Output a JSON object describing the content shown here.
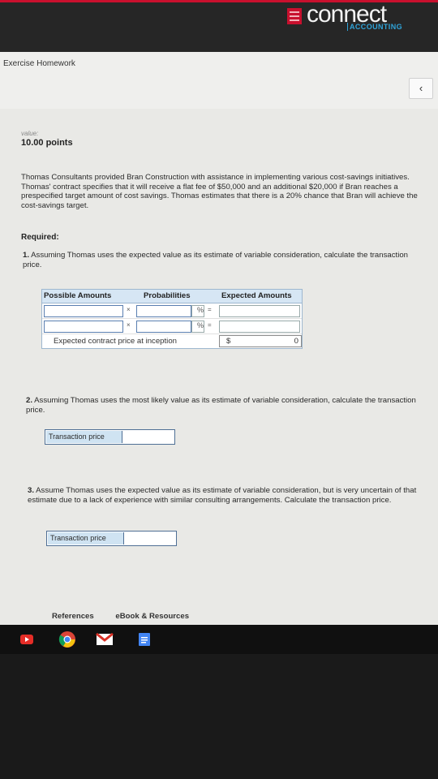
{
  "brand": {
    "name": "connect",
    "sub": "ACCOUNTING"
  },
  "header": {
    "title": "Exercise Homework",
    "back_icon": "chevron-left-icon",
    "back_glyph": "‹"
  },
  "value": {
    "label": "value:",
    "points": "10.00 points"
  },
  "problem_text": "Thomas Consultants provided Bran Construction with assistance in implementing various cost-savings initiatives. Thomas' contract specifies that it will receive a flat fee of $50,000 and an additional $20,000 if Bran reaches a prespecified target amount of cost savings. Thomas estimates that there is a 20% chance that Bran will achieve the cost-savings target.",
  "required_label": "Required:",
  "questions": [
    {
      "num": "1.",
      "text": "Assuming Thomas uses the expected value as its estimate of variable consideration, calculate the transaction price."
    },
    {
      "num": "2.",
      "text": "Assuming Thomas uses the most likely value as its estimate of variable consideration, calculate the transaction price."
    },
    {
      "num": "3.",
      "text": "Assume Thomas uses the expected value as its estimate of variable consideration, but is very uncertain of that estimate due to a lack of experience with similar consulting arrangements. Calculate the transaction price."
    }
  ],
  "table": {
    "headers": [
      "Possible Amounts",
      "Probabilities",
      "Expected Amounts"
    ],
    "times": "×",
    "percent": "%",
    "equals": "=",
    "total_label": "Expected contract price at inception",
    "currency": "$",
    "total_value": "0"
  },
  "transaction_price_label": "Transaction price",
  "bottom_tabs": [
    "References",
    "eBook & Resources"
  ],
  "colors": {
    "brand_red": "#c8102e",
    "brand_blue": "#2fa3d8",
    "table_header": "#d6e6f4"
  }
}
